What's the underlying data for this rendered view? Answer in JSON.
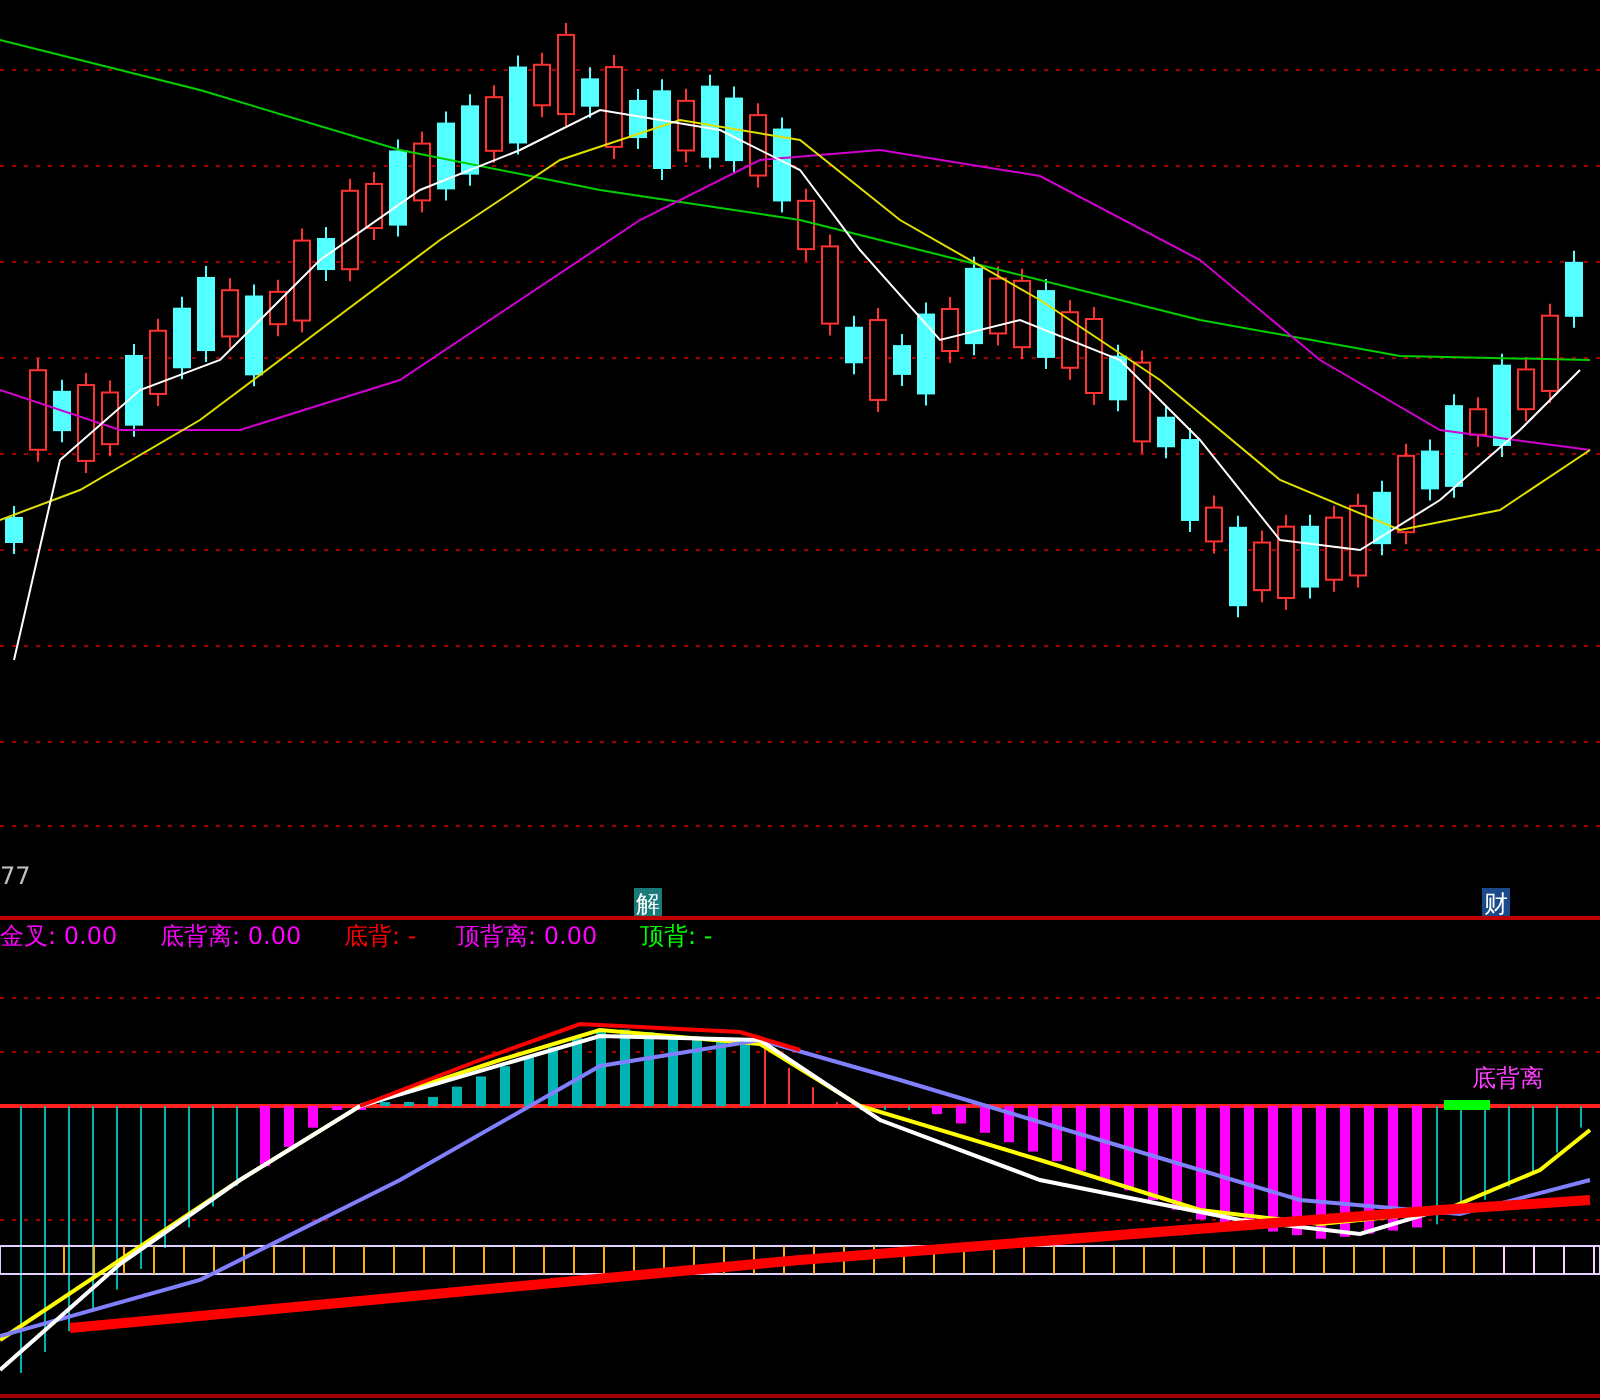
{
  "price_panel": {
    "corner_value": "77",
    "markers": [
      {
        "text": "解",
        "color": "#1a7a7a"
      },
      {
        "text": "财",
        "color": "#1a4a8a"
      }
    ]
  },
  "indicator_panel": {
    "legend": [
      {
        "label": "金叉:",
        "value": "0.00",
        "color": "#ff00ff"
      },
      {
        "label": "底背离:",
        "value": "0.00",
        "color": "#ff00ff"
      },
      {
        "label": "底背:",
        "value": "-",
        "color": "#ff0000"
      },
      {
        "label": "顶背离:",
        "value": "0.00",
        "color": "#ff00ff"
      },
      {
        "label": "顶背:",
        "value": "-",
        "color": "#00ff00"
      }
    ],
    "signal_label": "底背离"
  }
}
